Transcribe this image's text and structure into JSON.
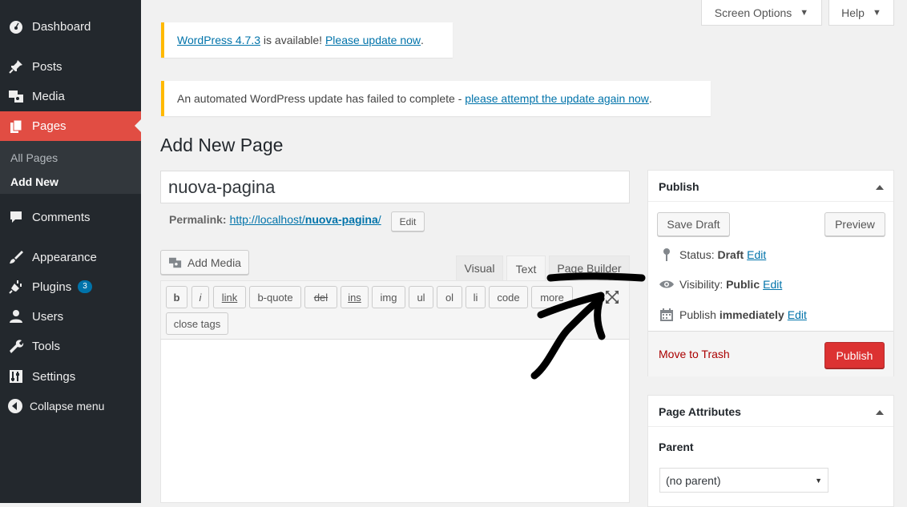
{
  "sidebar": {
    "items": [
      {
        "label": "Dashboard",
        "icon": "dashboard-icon"
      },
      {
        "label": "Posts",
        "icon": "pin-icon"
      },
      {
        "label": "Media",
        "icon": "media-icon"
      },
      {
        "label": "Pages",
        "icon": "pages-icon"
      },
      {
        "label": "Comments",
        "icon": "comment-icon"
      },
      {
        "label": "Appearance",
        "icon": "brush-icon"
      },
      {
        "label": "Plugins",
        "icon": "plug-icon",
        "badge": "3"
      },
      {
        "label": "Users",
        "icon": "user-icon"
      },
      {
        "label": "Tools",
        "icon": "wrench-icon"
      },
      {
        "label": "Settings",
        "icon": "settings-icon"
      },
      {
        "label": "Collapse menu",
        "icon": "collapse-icon"
      }
    ],
    "submenu": [
      "All Pages",
      "Add New"
    ]
  },
  "topbar": {
    "screen_options": "Screen Options",
    "help": "Help"
  },
  "notices": {
    "update_link": "WordPress 4.7.3",
    "update_mid": " is available! ",
    "update_now": "Please update now",
    "update_end": ".",
    "failed_text": "An automated WordPress update has failed to complete - ",
    "failed_link": "please attempt the update again now",
    "failed_end": "."
  },
  "page_heading": "Add New Page",
  "title_value": "nuova-pagina",
  "permalink": {
    "label": "Permalink:",
    "base": "http://localhost/",
    "slug": "nuova-pagina",
    "tail": "/",
    "edit": "Edit"
  },
  "editor": {
    "add_media": "Add Media",
    "tabs": [
      "Visual",
      "Text",
      "Page Builder"
    ],
    "quicktags": [
      "b",
      "i",
      "link",
      "b-quote",
      "del",
      "ins",
      "img",
      "ul",
      "ol",
      "li",
      "code",
      "more",
      "close tags"
    ]
  },
  "publish": {
    "title": "Publish",
    "save_draft": "Save Draft",
    "preview": "Preview",
    "status_label": "Status:",
    "status_value": "Draft",
    "visibility_label": "Visibility:",
    "visibility_value": "Public",
    "publish_label": "Publish",
    "publish_value": "immediately",
    "edit": "Edit",
    "trash": "Move to Trash",
    "publish_button": "Publish"
  },
  "attributes": {
    "title": "Page Attributes",
    "parent_label": "Parent",
    "parent_value": "(no parent)"
  },
  "colors": {
    "accent": "#0073aa",
    "active_menu": "#e14d43",
    "sidebar": "#23282d",
    "publish_button": "#dc3232",
    "notice_border": "#ffb900"
  }
}
